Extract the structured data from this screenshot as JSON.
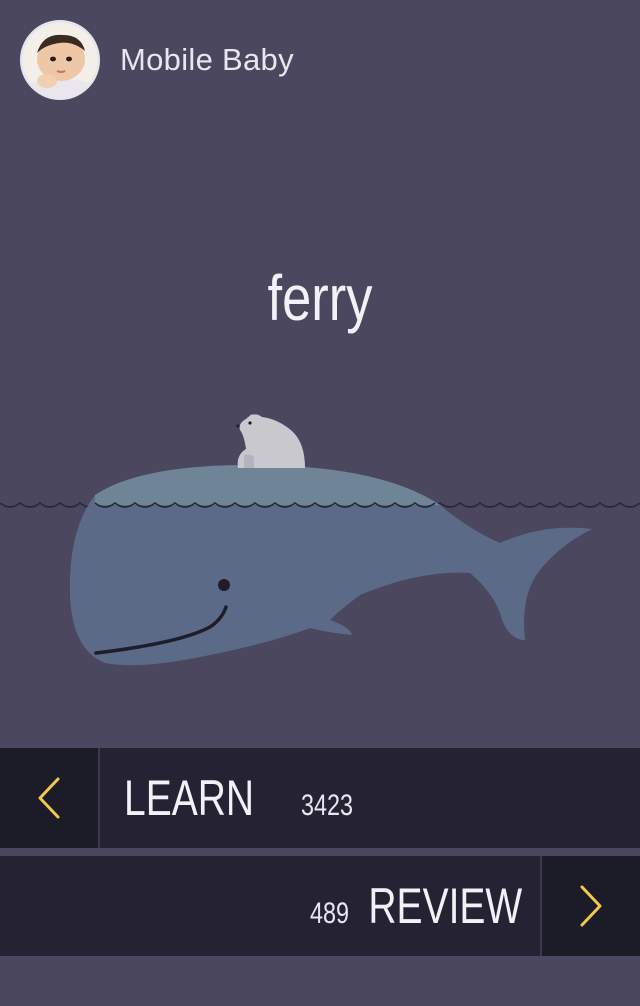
{
  "profile": {
    "name": "Mobile Baby"
  },
  "card": {
    "word": "ferry"
  },
  "learn": {
    "label": "LEARN",
    "count": "3423"
  },
  "review": {
    "label": "REVIEW",
    "count": "489"
  },
  "colors": {
    "background": "#4a475f",
    "bar": "#252333",
    "accent": "#f2c94c",
    "whale": "#5b6a86",
    "text": "#f2f1f6"
  },
  "icons": {
    "prev": "chevron-left-icon",
    "next": "chevron-right-icon"
  }
}
